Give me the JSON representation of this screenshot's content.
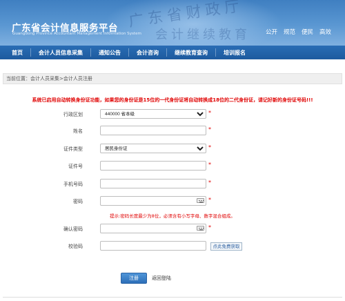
{
  "header": {
    "title": "广东省会计信息服务平台",
    "subtitle": "Guangdong Province Accountant Management Information System",
    "links": [
      "公开",
      "规范",
      "便民",
      "高效"
    ]
  },
  "nav": {
    "items": [
      "首页",
      "会计人员信息采集",
      "通知公告",
      "会计咨询",
      "继续教育查询",
      "培训报名"
    ]
  },
  "breadcrumb": "当前位置：会计人员采集>会计人员注册",
  "notice": "系统已启用自动转换身份证功能，如果您的身份证是15位的一代身份证将自动转换成18位的二代身份证，请记好新的身份证号码!!!",
  "form": {
    "region_label": "行政区划",
    "region_value": "440000 省本级",
    "name_label": "姓名",
    "name_value": "",
    "idtype_label": "证件类型",
    "idtype_value": "居民身份证",
    "idnum_label": "证件号",
    "idnum_value": "",
    "phone_label": "手机号码",
    "phone_value": "",
    "password_label": "密码",
    "password_value": "",
    "password_hint": "提示:密码长度最少为8位，必须含有小写字母、数字混合组成。",
    "confirm_label": "确认密码",
    "confirm_value": "",
    "captcha_label": "校验码",
    "captcha_value": "",
    "captcha_link": "点此免费获取",
    "required_mark": "*",
    "submit_label": "注册",
    "back_label": "返回登陆"
  },
  "colors": {
    "brand_blue": "#2a6db5",
    "required_red": "#e00000"
  }
}
